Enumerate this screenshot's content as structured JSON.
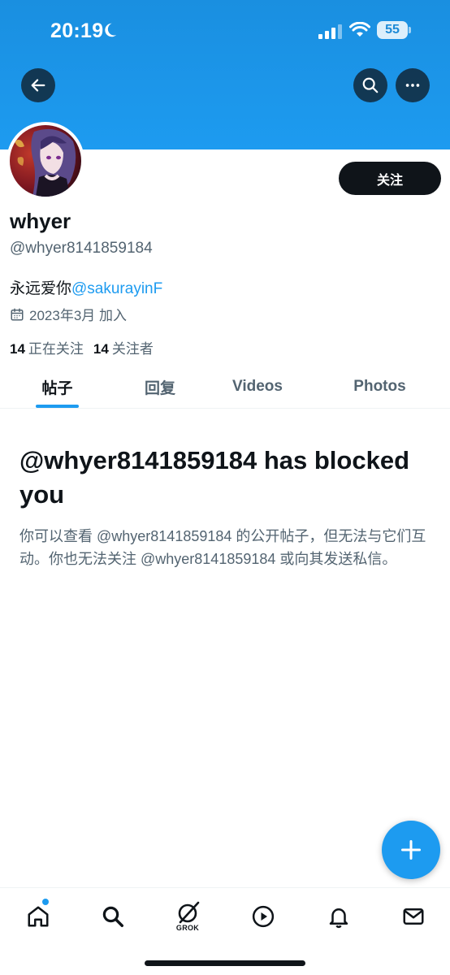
{
  "status_bar": {
    "time": "20:19",
    "battery": "55"
  },
  "profile": {
    "display_name": "whyer",
    "handle": "@whyer8141859184",
    "bio_text": "永远爱你",
    "bio_mention": "@sakurayinF",
    "joined": "2023年3月 加入",
    "following_count": "14",
    "following_label": "正在关注",
    "followers_count": "14",
    "followers_label": "关注者",
    "follow_button": "关注"
  },
  "tabs": [
    {
      "label": "帖子"
    },
    {
      "label": "回复"
    },
    {
      "label": "Videos"
    },
    {
      "label": "Photos"
    }
  ],
  "blocked": {
    "title": "@whyer8141859184 has blocked you",
    "description": "你可以查看 @whyer8141859184 的公开帖子，但无法与它们互动。你也无法关注 @whyer8141859184 或向其发送私信。"
  },
  "bottom_nav": {
    "items": [
      "home-icon",
      "search-icon",
      "grok-icon",
      "video-play-icon",
      "notifications-bell-icon",
      "messages-mail-icon"
    ],
    "grok_label": "GROK"
  },
  "colors": {
    "accent": "#1d9bf0",
    "text": "#0f1419",
    "secondary": "#536471"
  }
}
